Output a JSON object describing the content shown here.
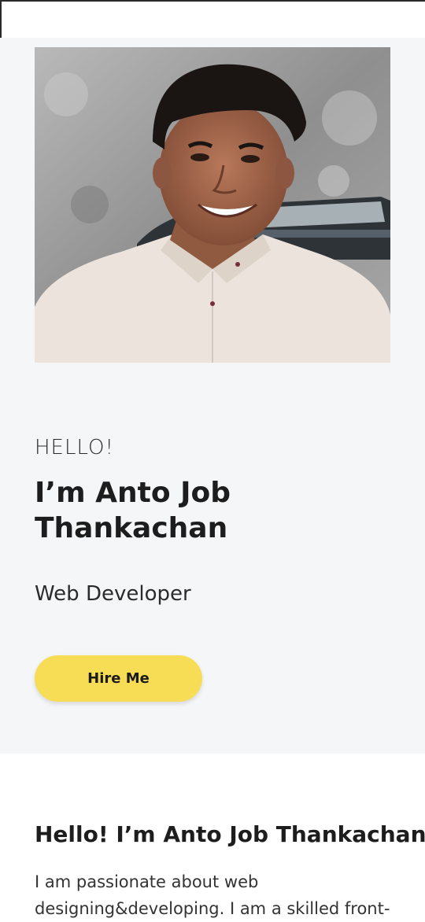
{
  "hero": {
    "greeting": "HELLO!",
    "name": "I’m Anto Job Thankachan",
    "role": "Web Developer",
    "hire_button": "Hire Me"
  },
  "about": {
    "title": "Hello! I’m Anto Job Thankachan",
    "text": "I am passionate about web designing&developing. I am a skilled front-"
  },
  "colors": {
    "hero_background": "#f5f6f8",
    "button_yellow": "#f7dc55",
    "text_dark": "#1d1d1d"
  }
}
